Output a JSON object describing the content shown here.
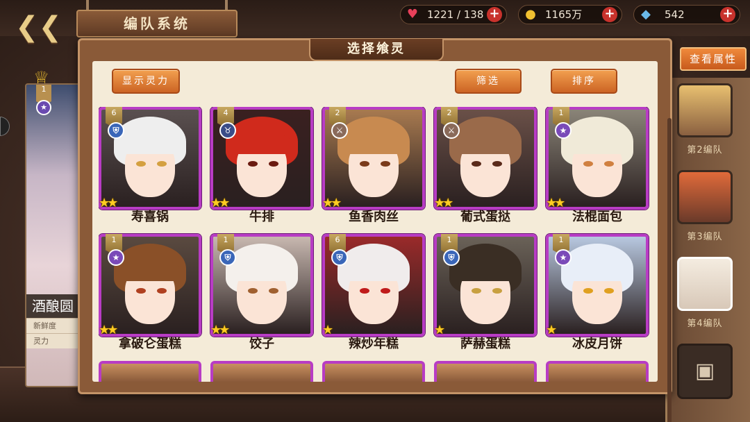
{
  "top": {
    "back_icon": "back-arrow-icon",
    "title": "编队系统",
    "stamina": "1221 / 138",
    "gold": "1165万",
    "gems": "542"
  },
  "left_panel": {
    "name": "酒酿圆",
    "rank": "1",
    "freshness_label": "新鲜度",
    "spirit_label": "灵力"
  },
  "right_panel": {
    "view_attr": "查看属性",
    "teams": [
      "第2编队",
      "第3编队",
      "第4编队"
    ]
  },
  "dialog": {
    "title": "选择飨灵",
    "show_spirit": "显示灵力",
    "filter": "筛选",
    "sort": "排序"
  },
  "cards": [
    {
      "name": "寿喜锅",
      "rank": "6",
      "stars": 2,
      "attr": "shield",
      "hair": "#eeeeee",
      "eye": "#d4a040",
      "bg": "#5a5050"
    },
    {
      "name": "牛排",
      "rank": "4",
      "stars": 2,
      "attr": "horn",
      "hair": "#d02a1c",
      "eye": "#6a1a10",
      "bg": "#3a2020"
    },
    {
      "name": "鱼香肉丝",
      "rank": "2",
      "stars": 2,
      "attr": "blade",
      "hair": "#c88a50",
      "eye": "#7a3a1a",
      "bg": "#a87a50"
    },
    {
      "name": "葡式蛋挞",
      "rank": "2",
      "stars": 2,
      "attr": "blade",
      "hair": "#9a6a4a",
      "eye": "#5a2a1a",
      "bg": "#6a5048"
    },
    {
      "name": "法棍面包",
      "rank": "1",
      "stars": 2,
      "attr": "star",
      "hair": "#f0ead8",
      "eye": "#d08040",
      "bg": "#8a8478"
    },
    {
      "name": "拿破仑蛋糕",
      "rank": "1",
      "stars": 2,
      "attr": "star",
      "hair": "#8a5028",
      "eye": "#b04020",
      "bg": "#5a4a40"
    },
    {
      "name": "饺子",
      "rank": "1",
      "stars": 2,
      "attr": "shield",
      "hair": "#f4f0ec",
      "eye": "#a06030",
      "bg": "#c8b8b0"
    },
    {
      "name": "辣炒年糕",
      "rank": "6",
      "stars": 1,
      "attr": "shield",
      "hair": "#f0ecec",
      "eye": "#c01a1a",
      "bg": "#9a2a2a"
    },
    {
      "name": "萨赫蛋糕",
      "rank": "1",
      "stars": 1,
      "attr": "shield",
      "hair": "#3a2e24",
      "eye": "#c8a040",
      "bg": "#6a6258"
    },
    {
      "name": "冰皮月饼",
      "rank": "1",
      "stars": 1,
      "attr": "star",
      "hair": "#e8eef8",
      "eye": "#e0a020",
      "bg": "#b8c8e0"
    }
  ]
}
